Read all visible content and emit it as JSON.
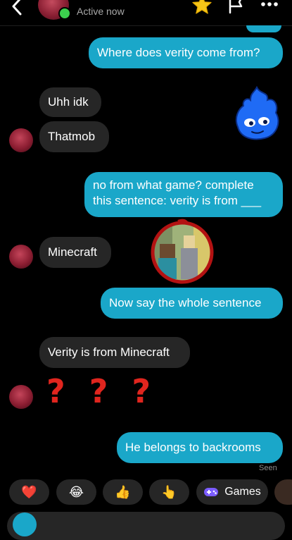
{
  "header": {
    "status": "Active now",
    "icons": [
      "back-chevron-icon",
      "star-icon",
      "flag-icon",
      "more-icon"
    ],
    "star_color": "#f5c518"
  },
  "messages": [
    {
      "side": "outgoing",
      "text": "Where does verity come from?"
    },
    {
      "side": "incoming",
      "text": "Uhh idk"
    },
    {
      "side": "incoming",
      "text": "Thatmob"
    },
    {
      "side": "outgoing",
      "text": "no from what game? complete this sentence: verity is from ___"
    },
    {
      "side": "incoming",
      "text": "Minecraft"
    },
    {
      "side": "outgoing",
      "text": "Now say the whole sentence"
    },
    {
      "side": "incoming",
      "text": "Verity is from Minecraft"
    },
    {
      "side": "incoming",
      "text": "? ? ?"
    },
    {
      "side": "outgoing",
      "text": "He belongs to backrooms"
    }
  ],
  "overlay_stickers": [
    "blue-flame-emoji-sticker",
    "minecraft-circle-sticker"
  ],
  "quick_reactions": [
    {
      "emoji": "❤️",
      "name": "heart"
    },
    {
      "emoji": "😂",
      "name": "joy"
    },
    {
      "emoji": "👍",
      "name": "thumbs-up"
    },
    {
      "emoji": "👆",
      "name": "pointing-up"
    },
    {
      "emoji": "",
      "name": "games",
      "label": "Games"
    }
  ],
  "colors": {
    "background": "#000000",
    "outgoing_bubble": "#1aa7c9",
    "incoming_bubble": "#262626",
    "question_mark": "#e0251e",
    "games_icon": "#7b5cff"
  }
}
